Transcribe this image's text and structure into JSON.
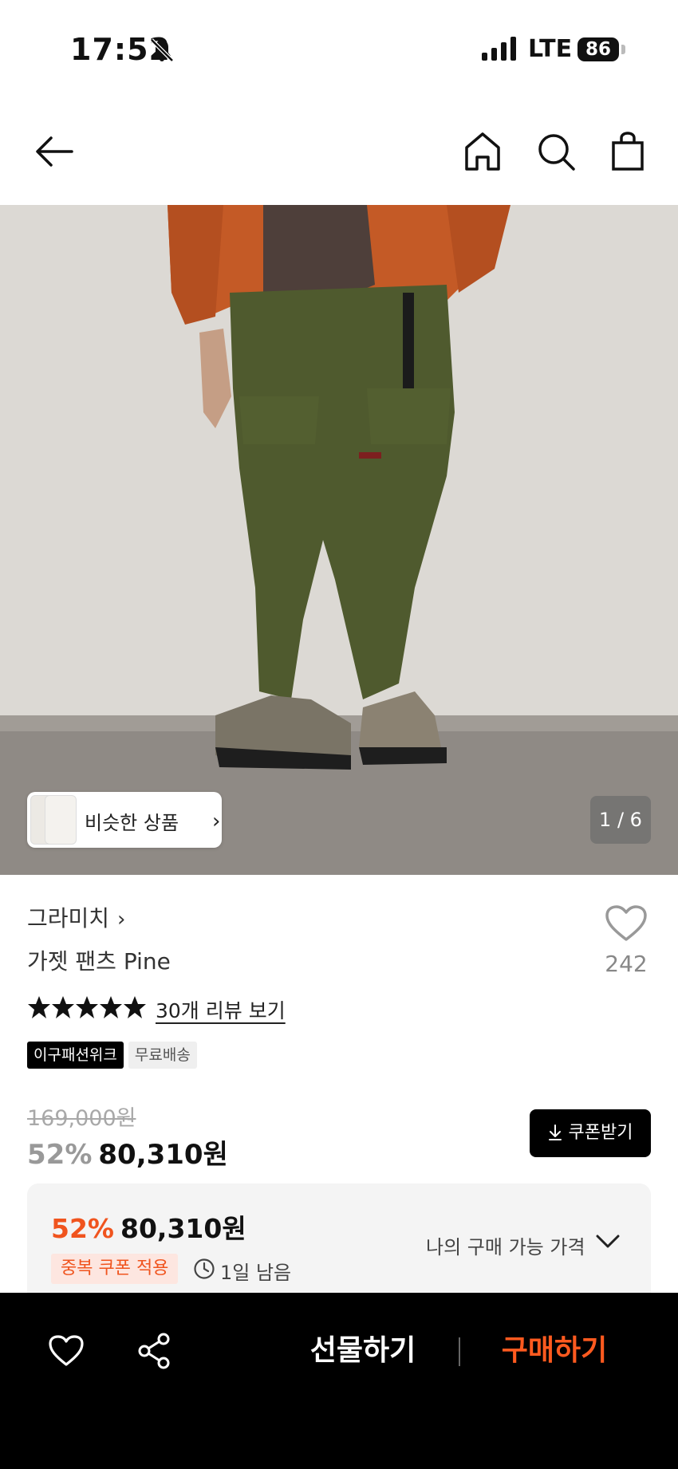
{
  "status_bar": {
    "time": "17:52",
    "network": "LTE",
    "battery": "86"
  },
  "nav": {
    "icons": [
      "back-arrow-icon",
      "home-icon",
      "search-icon",
      "shopping-bag-icon"
    ]
  },
  "gallery": {
    "similar_label": "비슷한 상품",
    "page_indicator": "1 / 6"
  },
  "product": {
    "brand": "그라미치",
    "name": "가젯 팬츠 Pine",
    "like_count": "242",
    "rating_stars": 5,
    "review_link": "30개 리뷰 보기",
    "tags": [
      "이구패션위크",
      "무료배송"
    ],
    "original_price": "169,000원",
    "discount": "52%",
    "price": "80,310원",
    "coupon_button": "쿠폰받기"
  },
  "my_price": {
    "discount": "52%",
    "price": "80,310원",
    "coupon_badge": "중복 쿠폰 적용",
    "remaining": "1일 남음",
    "label": "나의 구매 가능 가격"
  },
  "bottom_bar": {
    "gift_label": "선물하기",
    "buy_label": "구매하기"
  },
  "colors": {
    "accent": "#f0541e",
    "buy": "#ff5a1f",
    "dark": "#000000"
  }
}
